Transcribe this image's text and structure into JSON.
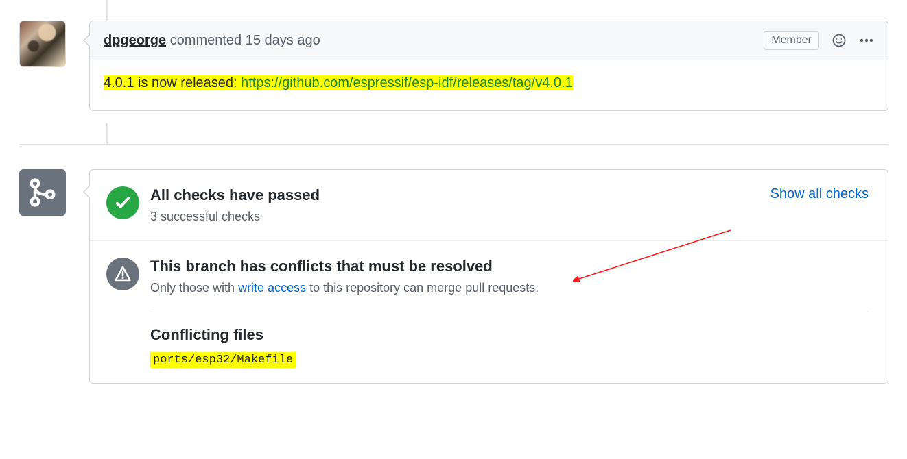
{
  "comment": {
    "author": "dpgeorge",
    "time": "commented 15 days ago",
    "badge": "Member",
    "body_prefix": "4.0.1 is now released: ",
    "body_link_text": "https://github.com/espressif/esp-idf/releases/tag/v4.0.1"
  },
  "checks": {
    "passed_title": "All checks have passed",
    "passed_sub": "3 successful checks",
    "show_all": "Show all checks",
    "conflict_title": "This branch has conflicts that must be resolved",
    "conflict_sub_pre": "Only those with ",
    "conflict_sub_link": "write access",
    "conflict_sub_post": " to this repository can merge pull requests.",
    "conflict_files_heading": "Conflicting files",
    "conflict_file": "ports/esp32/Makefile"
  }
}
